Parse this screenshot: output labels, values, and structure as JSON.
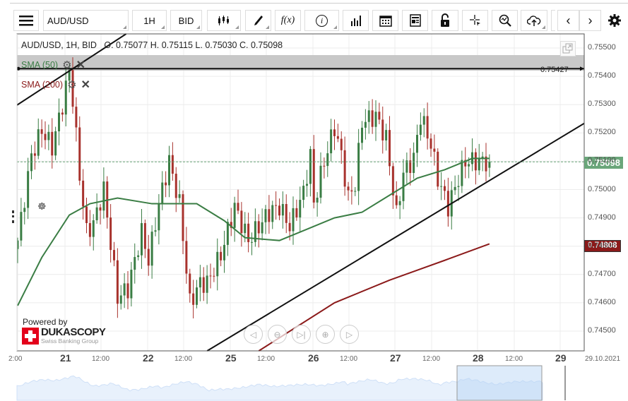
{
  "toolbar": {
    "symbol": "AUD/USD",
    "timeframe": "1H",
    "side": "BID",
    "function_label": "f(x)",
    "info_label": "i"
  },
  "chart_header": {
    "title": "AUD/USD, 1H, BID",
    "ohlc": "O. 0.75077 H. 0.75115 L. 0.75030 C. 0.75098"
  },
  "indicators": [
    {
      "label": "SMA (50)",
      "color": "#3a7d44"
    },
    {
      "label": "SMA (200)",
      "color": "#8b1a1a"
    }
  ],
  "branding": {
    "powered_by": "Powered by",
    "name": "DUKASCOPY",
    "tagline": "Swiss Banking Group"
  },
  "colors": {
    "up": "#3a7d44",
    "down": "#a8322d",
    "current": "#6aa67a",
    "sma200": "#8b1a1a"
  },
  "chart_data": {
    "type": "candlestick",
    "title": "AUD/USD, 1H, BID",
    "y_ticks": [
      "0.75500",
      "0.75400",
      "0.75300",
      "0.75200",
      "0.75100",
      "0.75000",
      "0.74900",
      "0.74800",
      "0.74700",
      "0.74600",
      "0.74500"
    ],
    "ylim": [
      0.7443,
      0.7555
    ],
    "x_ticks": [
      "2:00",
      "21",
      "12:00",
      "22",
      "12:00",
      "25",
      "12:00",
      "26",
      "12:00",
      "27",
      "12:00",
      "28",
      "12:00",
      "29",
      "29.10.2021"
    ],
    "current_price": "0.75098",
    "sma200_price": "0.74808",
    "horizontal_line": {
      "price": 0.75427,
      "label": "0.75427"
    },
    "approx_closes": {
      "note_units": "price",
      "hours_from_20_12h": [
        0,
        4,
        7,
        10,
        13,
        15,
        16,
        18,
        20,
        22,
        25,
        29,
        32,
        36,
        38,
        41,
        44,
        47,
        50,
        53,
        55,
        59,
        63,
        67,
        70,
        73,
        76,
        79,
        83,
        85,
        86,
        89,
        92,
        94,
        96,
        98,
        100,
        104,
        107,
        110,
        112,
        115,
        117,
        120,
        122,
        125,
        128,
        130,
        132,
        134,
        137
      ],
      "close": [
        0.7482,
        0.7512,
        0.7521,
        0.7515,
        0.753,
        0.7542,
        0.7532,
        0.7505,
        0.7485,
        0.7488,
        0.75,
        0.7462,
        0.7465,
        0.7485,
        0.7475,
        0.7495,
        0.751,
        0.7495,
        0.746,
        0.7467,
        0.7467,
        0.7477,
        0.7494,
        0.7482,
        0.7487,
        0.7492,
        0.7494,
        0.7487,
        0.7499,
        0.7512,
        0.7495,
        0.751,
        0.7522,
        0.7512,
        0.7497,
        0.7502,
        0.7524,
        0.7526,
        0.7518,
        0.7491,
        0.7506,
        0.7511,
        0.7526,
        0.7516,
        0.7504,
        0.7494,
        0.7504,
        0.751,
        0.751,
        0.751,
        0.75098
      ]
    },
    "sma50_approx": {
      "hours_from_20_12h": [
        0,
        7,
        15,
        21,
        29,
        39,
        52,
        60,
        66,
        76,
        84,
        92,
        100,
        108,
        116,
        124,
        132,
        137
      ],
      "value": [
        0.7459,
        0.7476,
        0.7491,
        0.7495,
        0.7497,
        0.7495,
        0.7495,
        0.7489,
        0.7483,
        0.7482,
        0.7486,
        0.749,
        0.7492,
        0.7498,
        0.7504,
        0.7507,
        0.7511,
        0.7511
      ]
    },
    "sma200_approx": {
      "hours_from_20_12h": [
        70,
        92,
        108,
        124,
        137
      ],
      "value": [
        0.7443,
        0.746,
        0.7468,
        0.7475,
        0.74808
      ]
    },
    "trendlines": [
      {
        "from": [
          0,
          0.753
        ],
        "to": [
          29,
          0.7553
        ]
      },
      {
        "from": [
          55,
          0.7443
        ],
        "to": [
          164,
          0.7523
        ]
      }
    ]
  }
}
